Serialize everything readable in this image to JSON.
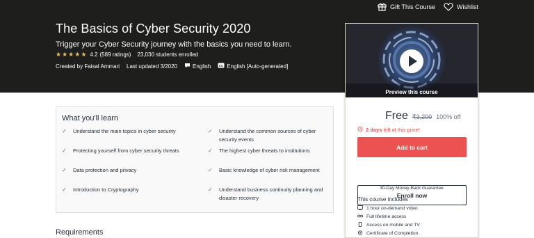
{
  "header": {
    "gift_label": "Gift This Course",
    "wishlist_label": "Wishlist",
    "title": "The Basics of Cyber Security 2020",
    "subtitle": "Trigger your Cyber Security journey with the basics you need to learn.",
    "rating": "4.2",
    "ratings_count": "(589 ratings)",
    "students": "23,030 students enrolled",
    "created_by": "Created by Faisal Ammari",
    "updated": "Last updated 3/2020",
    "language": "English",
    "captions": "English [Auto-generated]",
    "stars_filled": 4,
    "star_color": "#f4c150"
  },
  "sidebar": {
    "preview_label": "Preview this course",
    "price": "Free",
    "original_price": "₹3,200",
    "discount": "100% off",
    "timer_bold": "2 days",
    "timer_rest": "left at this price!",
    "add_to_cart": "Add to cart",
    "enroll": "Enroll now",
    "guarantee": "30-Day Money-Back Guarantee",
    "includes_title": "This course includes",
    "includes": [
      {
        "icon": "video-icon",
        "label": "1 hour on-demand video"
      },
      {
        "icon": "infinity-icon",
        "label": "Full lifetime access"
      },
      {
        "icon": "mobile-icon",
        "label": "Access on mobile and TV"
      },
      {
        "icon": "certificate-icon",
        "label": "Certificate of Completion"
      }
    ],
    "accent_color": "#ec5252"
  },
  "learn": {
    "title": "What you'll learn",
    "items": [
      "Understand the main topics in cyber security",
      "Understand the common sources of cyber security events",
      "Protecting yourself from cyber security threats",
      "The highest cyber threats to institutions",
      "Data protection and privacy",
      "Basic knowledge of cyber risk management",
      "Introduction to Cryptography",
      "Understand business continuity planning and disaster recovery"
    ]
  },
  "requirements": {
    "title": "Requirements"
  }
}
